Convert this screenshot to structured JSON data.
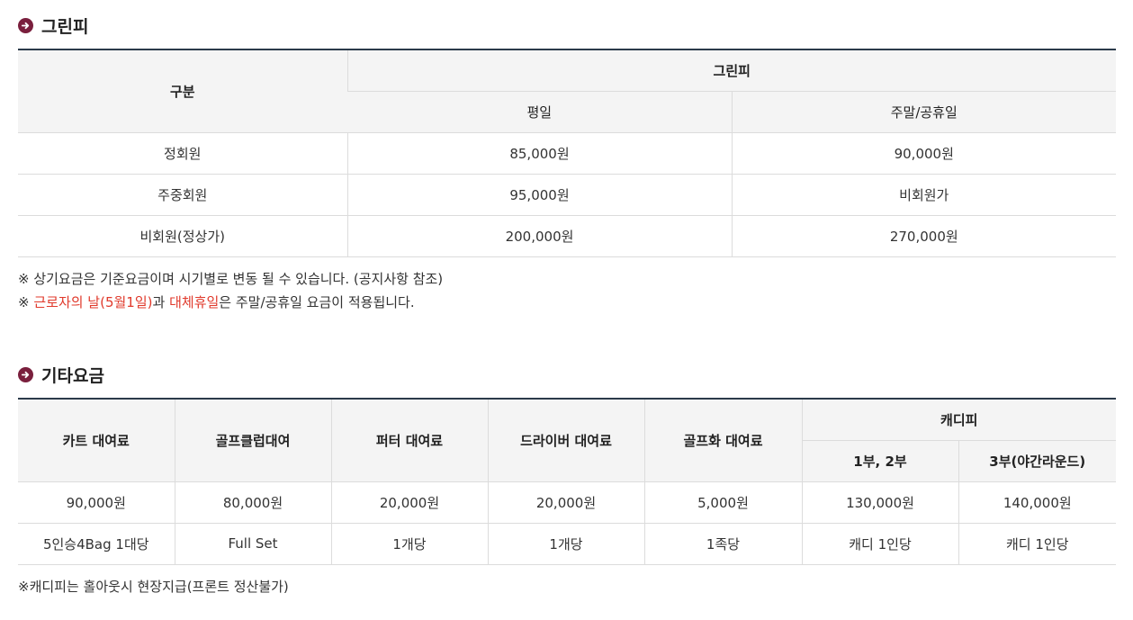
{
  "greenfee": {
    "title": "그린피",
    "header": {
      "category": "구분",
      "group": "그린피",
      "weekday": "평일",
      "weekend": "주말/공휴일"
    },
    "rows": [
      {
        "label": "정회원",
        "weekday": "85,000원",
        "weekend": "90,000원"
      },
      {
        "label": "주중회원",
        "weekday": "95,000원",
        "weekend": "비회원가"
      },
      {
        "label": "비회원(정상가)",
        "weekday": "200,000원",
        "weekend": "270,000원"
      }
    ],
    "note1": "※ 상기요금은 기준요금이며 시기별로 변동 될 수 있습니다. (공지사항 참조)",
    "note2": {
      "prefix": "※ ",
      "red1": "근로자의 날(5월1일)",
      "mid": "과 ",
      "red2": "대체휴일",
      "suffix": "은 주말/공휴일 요금이 적용됩니다."
    }
  },
  "otherfee": {
    "title": "기타요금",
    "header": {
      "cart": "카트 대여료",
      "club": "골프클럽대여",
      "putter": "퍼터 대여료",
      "driver": "드라이버 대여료",
      "shoes": "골프화 대여료",
      "caddie": "캐디피",
      "caddie_part12": "1부, 2부",
      "caddie_part3": "3부(야간라운드)"
    },
    "row_price": [
      "90,000원",
      "80,000원",
      "20,000원",
      "20,000원",
      "5,000원",
      "130,000원",
      "140,000원"
    ],
    "row_unit": [
      "5인승4Bag 1대당",
      "Full Set",
      "1개당",
      "1개당",
      "1족당",
      "캐디 1인당",
      "캐디 1인당"
    ],
    "note": "※캐디피는 홀아웃시 현장지급(프론트 정산불가)"
  },
  "colors": {
    "accent": "#7a1f3d",
    "table_top_border": "#2b3a4a",
    "highlight_red": "#e0392b",
    "header_bg": "#f4f4f4"
  },
  "icons": {
    "section_bullet": "circle-arrow-right-icon"
  }
}
